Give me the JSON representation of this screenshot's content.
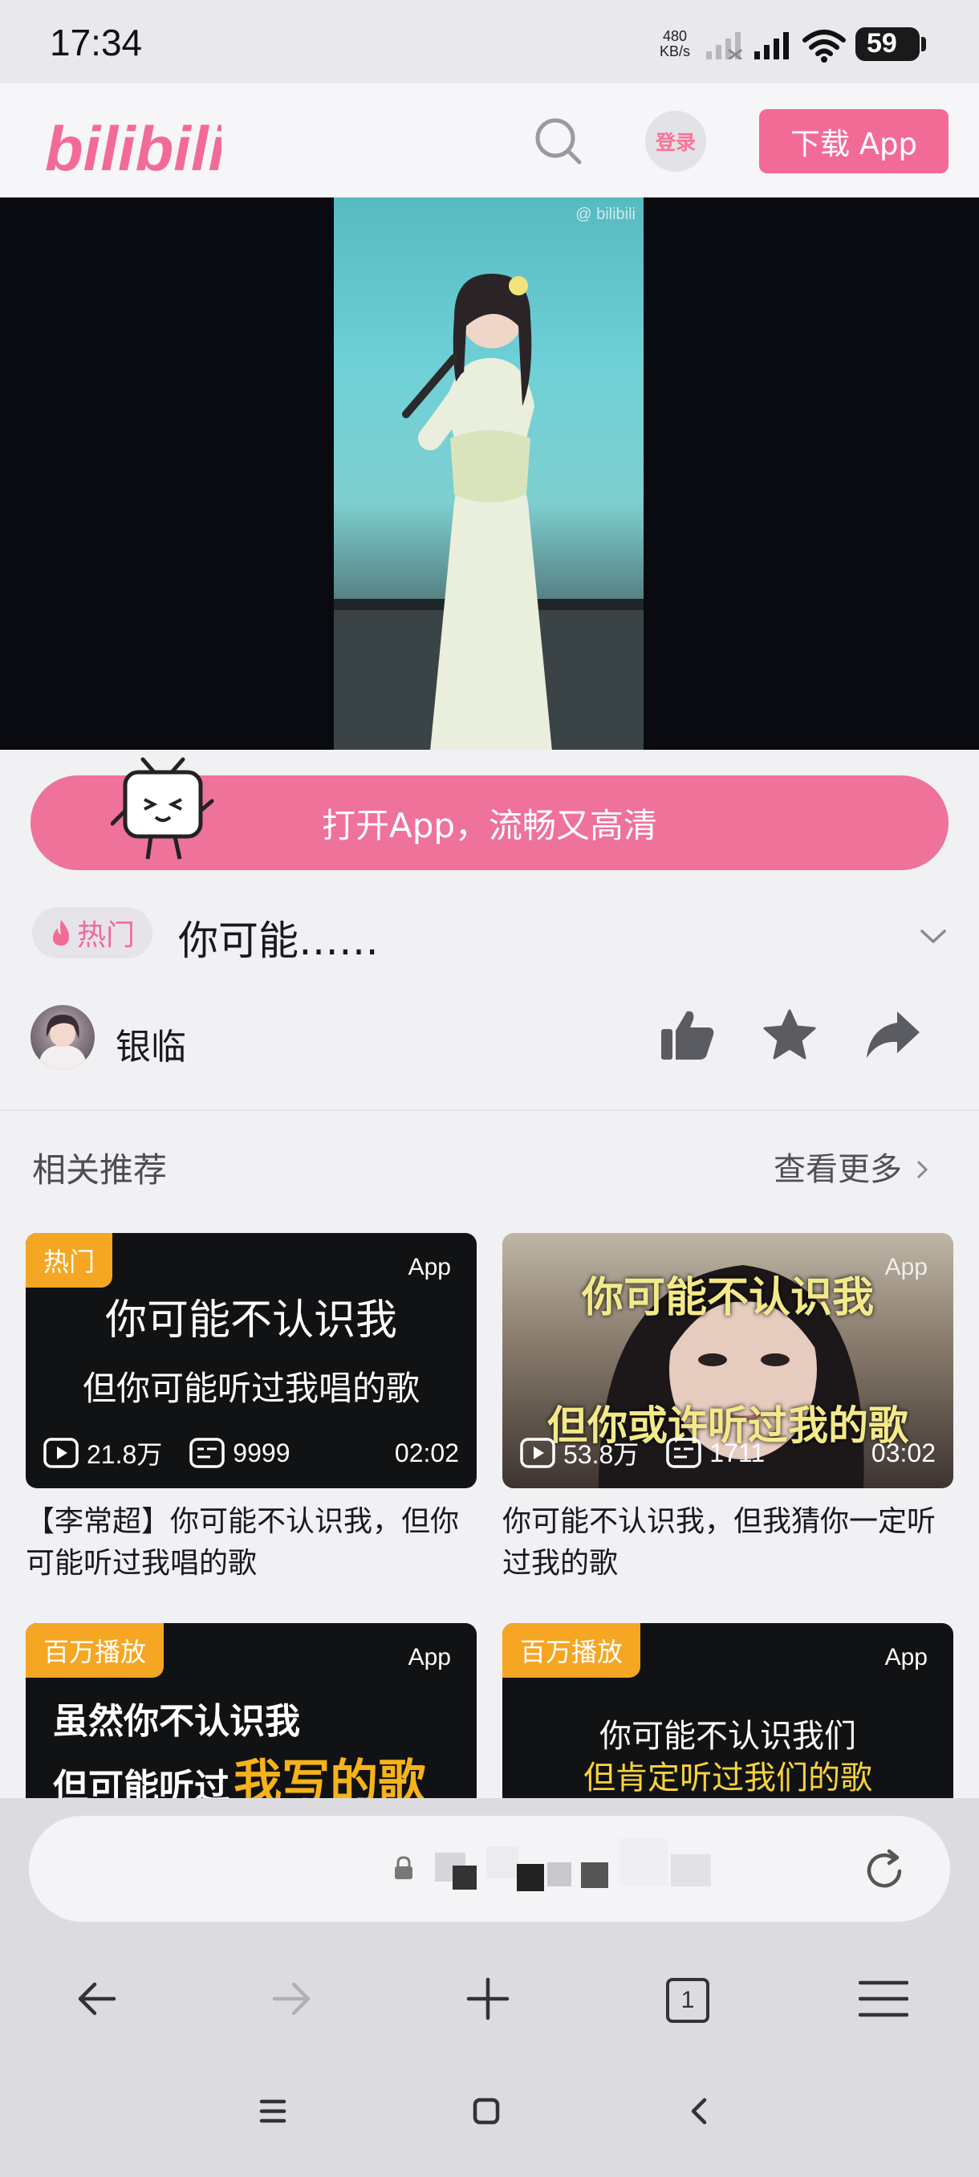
{
  "status_bar": {
    "time": "17:34",
    "net_speed_value": "480",
    "net_speed_unit": "KB/s",
    "battery": "59"
  },
  "header": {
    "logo": "bilibili",
    "login_label": "登录",
    "download_label": "下载 App"
  },
  "player": {
    "watermark": "@ bilibili"
  },
  "banner": {
    "open_app_label": "打开App，流畅又高清"
  },
  "video": {
    "hot_label": "热门",
    "title": "你可能……",
    "uploader": "银临"
  },
  "recommend": {
    "heading": "相关推荐",
    "see_more": "查看更多",
    "cards": [
      {
        "tag": "热门",
        "app_label": "App",
        "thumb_line1": "你可能不认识我",
        "thumb_line2": "但你可能听过我唱的歌",
        "views": "21.8万",
        "danmaku": "9999",
        "duration": "02:02",
        "title": "【李常超】你可能不认识我，但你可能听过我唱的歌"
      },
      {
        "tag": "",
        "app_label": "App",
        "thumb_line1": "你可能不认识我",
        "thumb_line2": "但你或许听过我的歌",
        "views": "53.8万",
        "danmaku": "1711",
        "duration": "03:02",
        "title": "你可能不认识我，但我猜你一定听过我的歌"
      },
      {
        "tag": "百万播放",
        "app_label": "App",
        "thumb_line1": "虽然你不认识我",
        "thumb_line2a": "但可能听过",
        "thumb_line2b": "我写的歌"
      },
      {
        "tag": "百万播放",
        "app_label": "App",
        "thumb_line1": "你可能不认识我们",
        "thumb_line2": "但肯定听过我们的歌"
      }
    ]
  },
  "browser": {
    "tab_count": "1"
  },
  "colors": {
    "accent": "#f26b97",
    "tag": "#f5a623",
    "action_icon": "#5b5c61"
  }
}
